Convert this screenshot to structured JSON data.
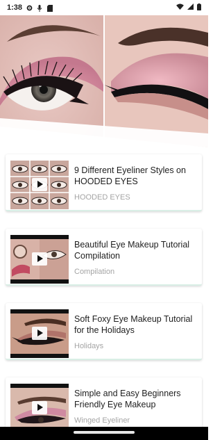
{
  "status": {
    "time": "1:38",
    "icons": [
      "settings-icon",
      "microphone-icon",
      "sd-card-icon",
      "wifi-icon",
      "signal-icon",
      "battery-icon"
    ]
  },
  "header": {
    "image": "eye-makeup-header-photo"
  },
  "videos": [
    {
      "title": "9 Different Eyeliner Styles on HOODED EYES",
      "category": "HOODED EYES"
    },
    {
      "title": "Beautiful Eye Makeup Tutorial Compilation",
      "category": "Compilation"
    },
    {
      "title": "Soft Foxy Eye Makeup Tutorial for the Holidays",
      "category": "Holidays"
    },
    {
      "title": "Simple and Easy Beginners Friendly Eye Makeup",
      "category": "Winged Eyeliner"
    }
  ],
  "colors": {
    "accent_border": "#d9efe6",
    "category_text": "#a4a4a4",
    "title_text": "#1e1e1e"
  }
}
